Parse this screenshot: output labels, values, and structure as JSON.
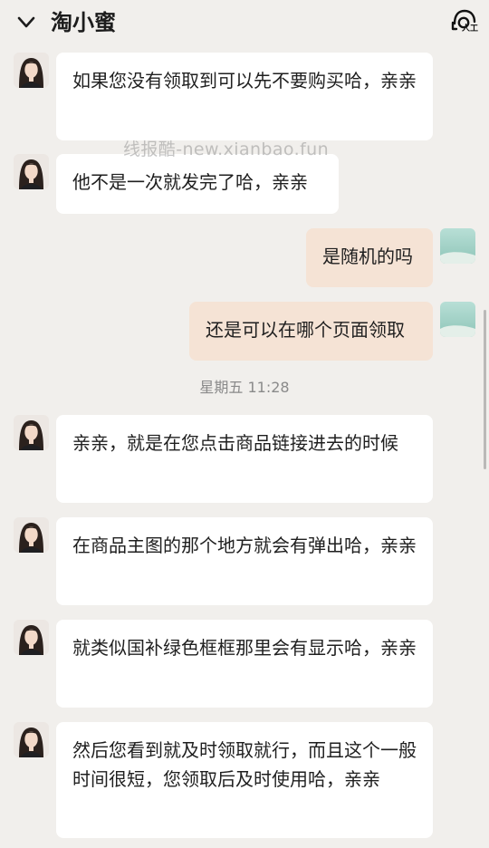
{
  "header": {
    "title": "淘小蜜",
    "human_label": "人工"
  },
  "watermark": "线报酷-new.xianbao.fun",
  "timestamp": "星期五 11:28",
  "messages": [
    {
      "from": "agent",
      "text": "如果您没有领取到可以先不要购买哈，亲亲"
    },
    {
      "from": "agent",
      "text": "他不是一次就发完了哈，亲亲"
    },
    {
      "from": "user",
      "text": "是随机的吗"
    },
    {
      "from": "user",
      "text": "还是可以在哪个页面领取"
    },
    {
      "from": "agent",
      "text": "亲亲，就是在您点击商品链接进去的时候"
    },
    {
      "from": "agent",
      "text": "在商品主图的那个地方就会有弹出哈，亲亲"
    },
    {
      "from": "agent",
      "text": "就类似国补绿色框框那里会有显示哈，亲亲"
    },
    {
      "from": "agent",
      "text": "然后您看到就及时领取就行，而且这个一般时间很短，您领取后及时使用哈，亲亲"
    }
  ]
}
